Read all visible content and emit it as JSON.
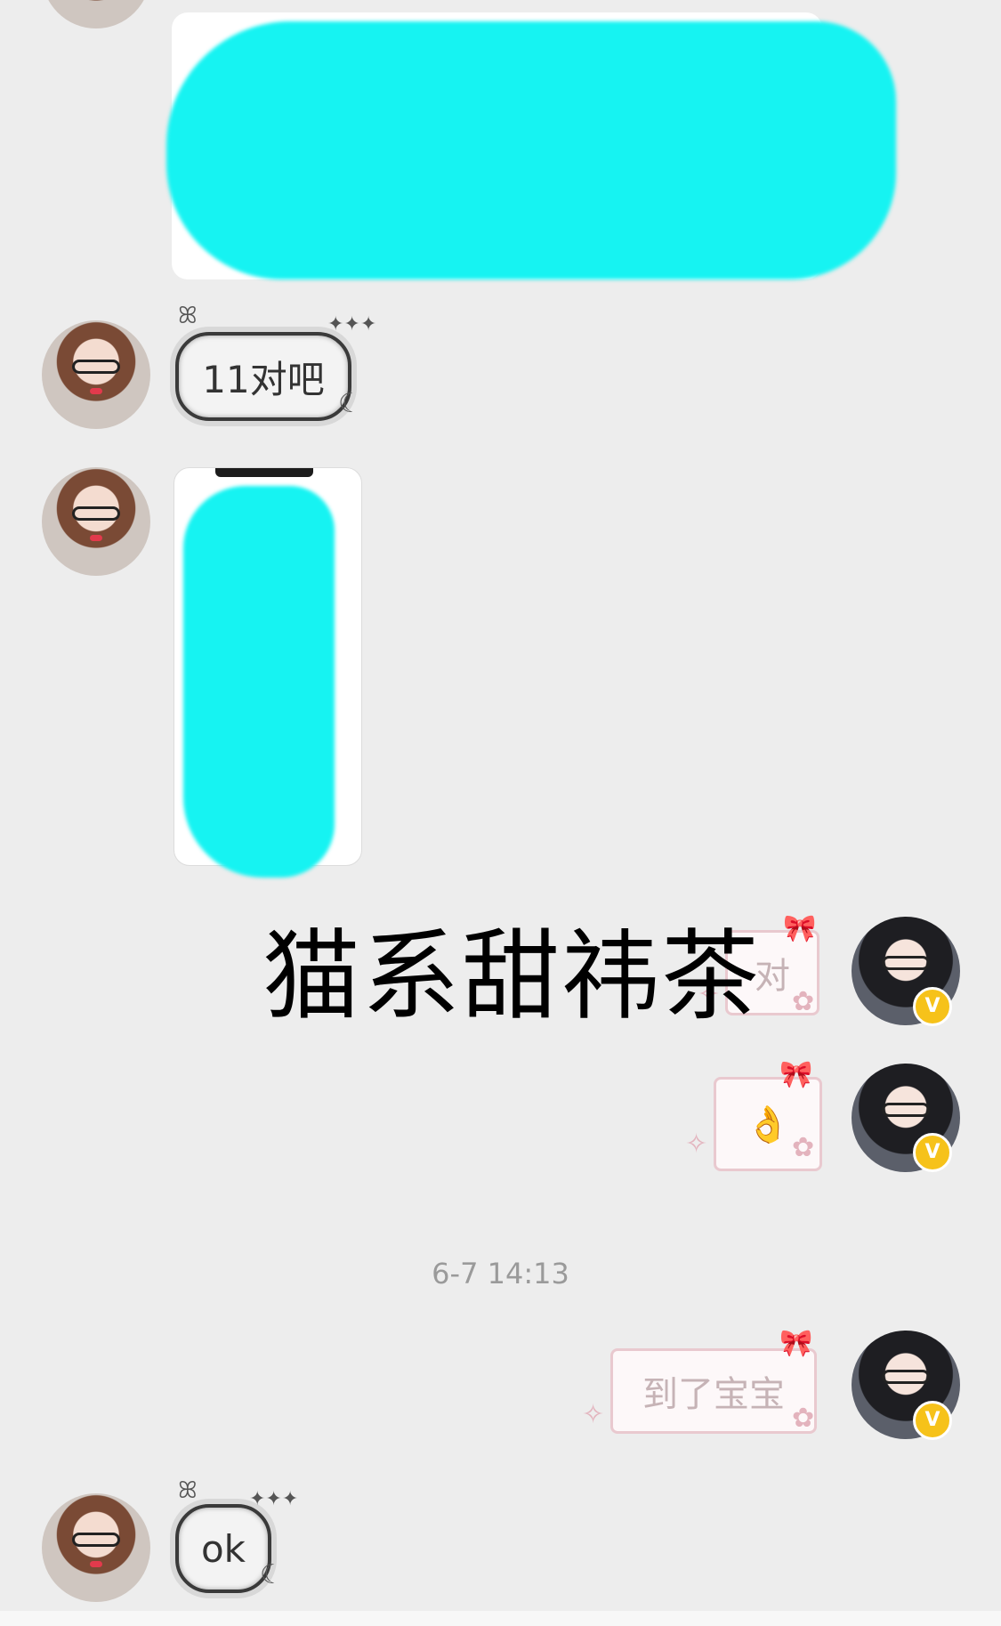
{
  "messages": {
    "m1_text": "11对吧",
    "m2_text": "对",
    "m3_emoji": "👌",
    "m4_text": "到了宝宝",
    "m5_text": "ok"
  },
  "timestamp": "6-7 14:13",
  "overlay_text": "猫系甜祎茶",
  "icons": {
    "vip_badge": "V"
  }
}
